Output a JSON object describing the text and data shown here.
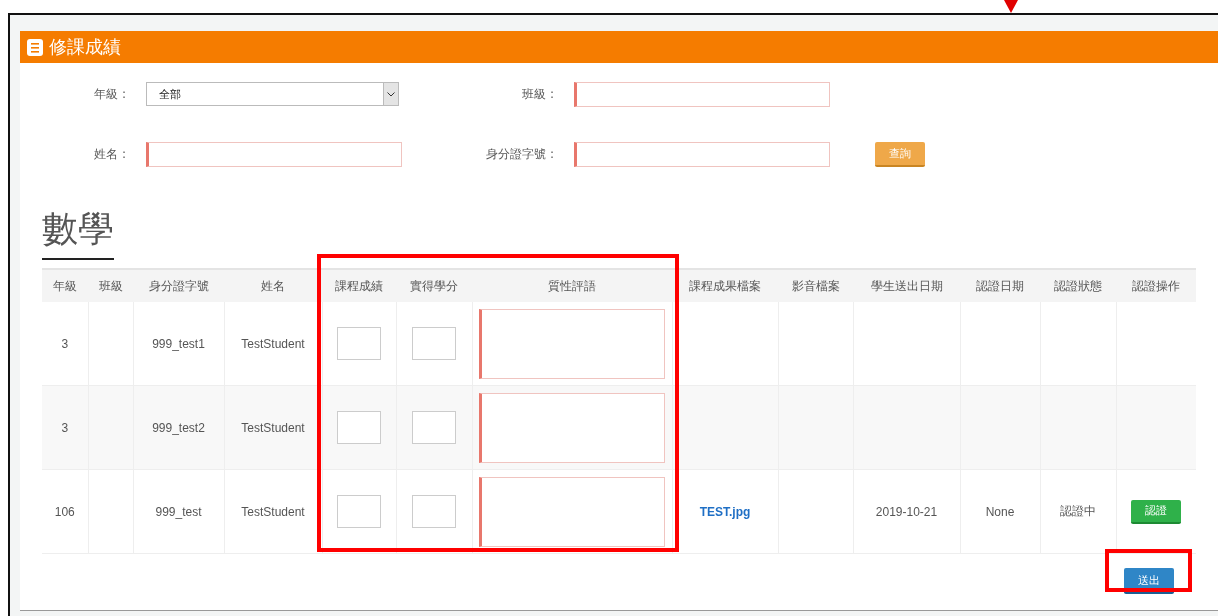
{
  "header": {
    "title": "修課成績"
  },
  "filters": [
    {
      "kind": "select",
      "label": "年級 :",
      "value": "全部"
    },
    {
      "kind": "text",
      "label": "班級 :"
    },
    {
      "kind": "text",
      "label": "姓名 :"
    },
    {
      "kind": "text",
      "label": "身分證字號 :"
    }
  ],
  "query_button": "查詢",
  "subject": "數學",
  "table": {
    "columns": [
      "年級",
      "班級",
      "身分證字號",
      "姓名",
      "課程成績",
      "實得學分",
      "質性評語",
      "課程成果檔案",
      "影音檔案",
      "學生送出日期",
      "認證日期",
      "認證狀態",
      "認證操作"
    ],
    "rows": [
      {
        "grade": "3",
        "id": "999_test1",
        "name": "TestStudent"
      },
      {
        "grade": "3",
        "id": "999_test2",
        "name": "TestStudent"
      },
      {
        "grade": "106",
        "id": "999_test",
        "name": "TestStudent",
        "file": "TEST.jpg",
        "sent_date": "2019-10-21",
        "cert_date": "None",
        "status": "認證中",
        "action": "認證"
      }
    ]
  },
  "submit_button": "送出"
}
